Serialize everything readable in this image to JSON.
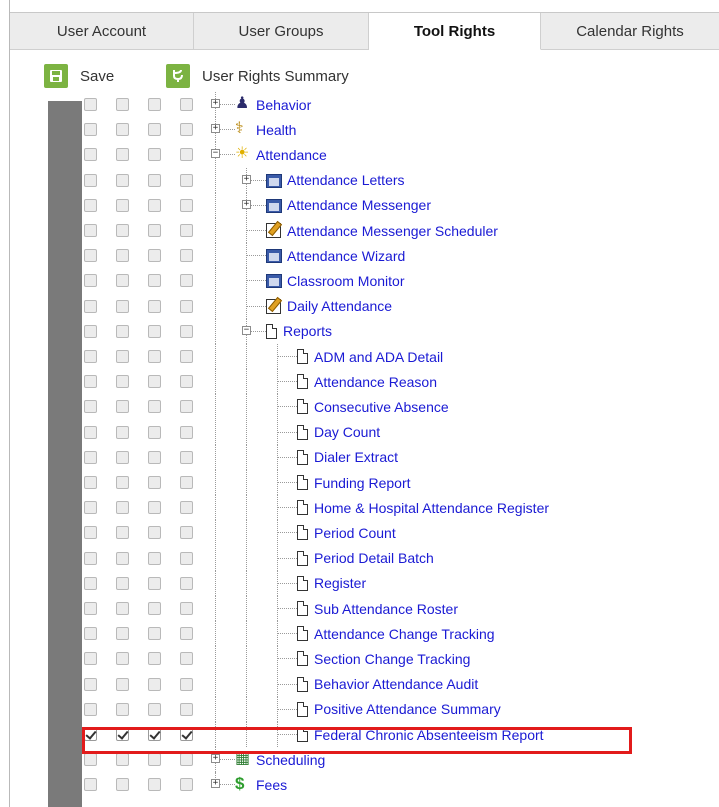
{
  "tabs": [
    {
      "label": "User Account",
      "active": false
    },
    {
      "label": "User Groups",
      "active": false
    },
    {
      "label": "Tool Rights",
      "active": true
    },
    {
      "label": "Calendar Rights",
      "active": false
    }
  ],
  "toolbar": {
    "save_label": "Save",
    "summary_label": "User Rights Summary"
  },
  "tree": [
    {
      "label": "Behavior",
      "level": 0,
      "icon": "behavior-icon",
      "expander": "plus",
      "checked": false
    },
    {
      "label": "Health",
      "level": 0,
      "icon": "health-icon",
      "expander": "plus",
      "checked": false
    },
    {
      "label": "Attendance",
      "level": 0,
      "icon": "attendance-icon",
      "expander": "minus",
      "checked": false
    },
    {
      "label": "Attendance Letters",
      "level": 1,
      "icon": "window-icon",
      "expander": "plus",
      "checked": false
    },
    {
      "label": "Attendance Messenger",
      "level": 1,
      "icon": "window-icon",
      "expander": "plus",
      "checked": false
    },
    {
      "label": "Attendance Messenger Scheduler",
      "level": 1,
      "icon": "edit-icon",
      "expander": "none",
      "checked": false
    },
    {
      "label": "Attendance Wizard",
      "level": 1,
      "icon": "window-icon",
      "expander": "none",
      "checked": false
    },
    {
      "label": "Classroom Monitor",
      "level": 1,
      "icon": "window-icon",
      "expander": "none",
      "checked": false
    },
    {
      "label": "Daily Attendance",
      "level": 1,
      "icon": "edit-icon",
      "expander": "none",
      "checked": false
    },
    {
      "label": "Reports",
      "level": 1,
      "icon": "document-icon",
      "expander": "minus",
      "checked": false
    },
    {
      "label": "ADM and ADA Detail",
      "level": 2,
      "icon": "document-icon",
      "expander": "none",
      "checked": false
    },
    {
      "label": "Attendance Reason",
      "level": 2,
      "icon": "document-icon",
      "expander": "none",
      "checked": false
    },
    {
      "label": "Consecutive Absence",
      "level": 2,
      "icon": "document-icon",
      "expander": "none",
      "checked": false
    },
    {
      "label": "Day Count",
      "level": 2,
      "icon": "document-icon",
      "expander": "none",
      "checked": false
    },
    {
      "label": "Dialer Extract",
      "level": 2,
      "icon": "document-icon",
      "expander": "none",
      "checked": false
    },
    {
      "label": "Funding Report",
      "level": 2,
      "icon": "document-icon",
      "expander": "none",
      "checked": false
    },
    {
      "label": "Home & Hospital Attendance Register",
      "level": 2,
      "icon": "document-icon",
      "expander": "none",
      "checked": false
    },
    {
      "label": "Period Count",
      "level": 2,
      "icon": "document-icon",
      "expander": "none",
      "checked": false
    },
    {
      "label": "Period Detail Batch",
      "level": 2,
      "icon": "document-icon",
      "expander": "none",
      "checked": false
    },
    {
      "label": "Register",
      "level": 2,
      "icon": "document-icon",
      "expander": "none",
      "checked": false
    },
    {
      "label": "Sub Attendance Roster",
      "level": 2,
      "icon": "document-icon",
      "expander": "none",
      "checked": false
    },
    {
      "label": "Attendance Change Tracking",
      "level": 2,
      "icon": "document-icon",
      "expander": "none",
      "checked": false
    },
    {
      "label": "Section Change Tracking",
      "level": 2,
      "icon": "document-icon",
      "expander": "none",
      "checked": false
    },
    {
      "label": "Behavior Attendance Audit",
      "level": 2,
      "icon": "document-icon",
      "expander": "none",
      "checked": false
    },
    {
      "label": "Positive Attendance Summary",
      "level": 2,
      "icon": "document-icon",
      "expander": "none",
      "checked": false
    },
    {
      "label": "Federal Chronic Absenteeism Report",
      "level": 2,
      "icon": "document-icon",
      "expander": "none",
      "checked": true,
      "highlighted": true
    },
    {
      "label": "Scheduling",
      "level": 0,
      "icon": "scheduling-icon",
      "expander": "plus",
      "checked": false
    },
    {
      "label": "Fees",
      "level": 0,
      "icon": "fees-icon",
      "expander": "plus",
      "checked": false
    }
  ],
  "colors": {
    "link": "#1a1ad4",
    "accent_green": "#7cb342",
    "highlight_red": "#e21b1b",
    "side_bar_grey": "#7a7a7a"
  }
}
